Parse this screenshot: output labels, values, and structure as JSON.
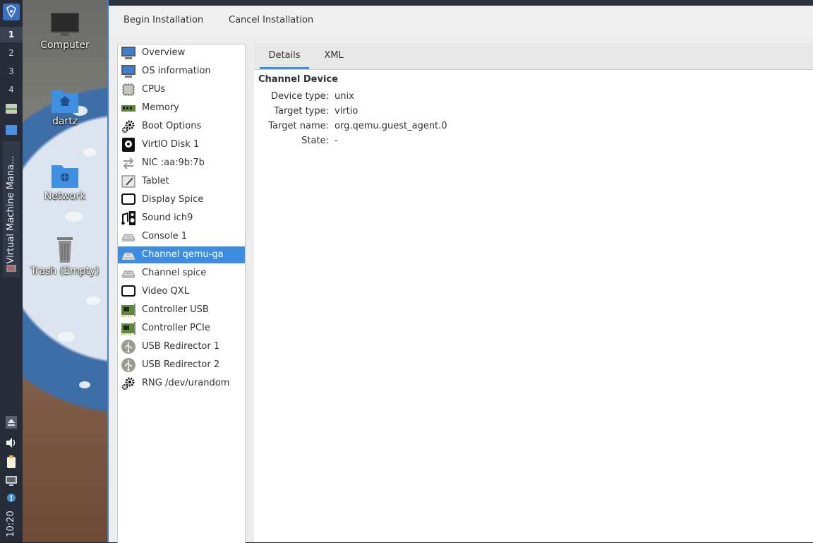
{
  "taskbar": {
    "workspaces": [
      "1",
      "2",
      "3",
      "4"
    ],
    "active_workspace": "1",
    "task_label": "Virtual Machine Mana...",
    "clock": "10:20"
  },
  "desktop": {
    "icons": [
      {
        "label": "Computer",
        "icon": "computer-icon"
      },
      {
        "label": "dartz",
        "icon": "home-folder-icon"
      },
      {
        "label": "Network",
        "icon": "network-folder-icon"
      },
      {
        "label": "Trash (Empty)",
        "icon": "trash-icon"
      }
    ]
  },
  "toolbar": {
    "begin_label": "Begin Installation",
    "cancel_label": "Cancel Installation"
  },
  "hardware_list": {
    "selected": "Channel qemu-ga",
    "items": [
      {
        "label": "Overview",
        "icon": "monitor-icon"
      },
      {
        "label": "OS information",
        "icon": "monitor-icon"
      },
      {
        "label": "CPUs",
        "icon": "cpu-chip-icon"
      },
      {
        "label": "Memory",
        "icon": "memory-stick-icon"
      },
      {
        "label": "Boot Options",
        "icon": "gear-icon"
      },
      {
        "label": "VirtIO Disk 1",
        "icon": "disk-icon"
      },
      {
        "label": "NIC :aa:9b:7b",
        "icon": "network-arrows-icon"
      },
      {
        "label": "Tablet",
        "icon": "tablet-pen-icon"
      },
      {
        "label": "Display Spice",
        "icon": "display-icon"
      },
      {
        "label": "Sound ich9",
        "icon": "sound-icon"
      },
      {
        "label": "Console 1",
        "icon": "serial-port-icon"
      },
      {
        "label": "Channel qemu-ga",
        "icon": "serial-port-icon"
      },
      {
        "label": "Channel spice",
        "icon": "serial-port-icon"
      },
      {
        "label": "Video QXL",
        "icon": "display-icon"
      },
      {
        "label": "Controller USB",
        "icon": "controller-card-icon"
      },
      {
        "label": "Controller PCIe",
        "icon": "controller-card-icon"
      },
      {
        "label": "USB Redirector 1",
        "icon": "usb-icon"
      },
      {
        "label": "USB Redirector 2",
        "icon": "usb-icon"
      },
      {
        "label": "RNG /dev/urandom",
        "icon": "gear-icon"
      }
    ]
  },
  "details": {
    "tabs": [
      {
        "label": "Details",
        "active": true
      },
      {
        "label": "XML",
        "active": false
      }
    ],
    "section_title": "Channel Device",
    "properties": [
      {
        "key": "Device type:",
        "value": "unix"
      },
      {
        "key": "Target type:",
        "value": "virtio"
      },
      {
        "key": "Target name:",
        "value": "org.qemu.guest_agent.0"
      },
      {
        "key": "State:",
        "value": "-"
      }
    ]
  },
  "colors": {
    "selection": "#3d8ee0",
    "taskbar": "#262c38",
    "window_accent": "#3c7fd8"
  }
}
